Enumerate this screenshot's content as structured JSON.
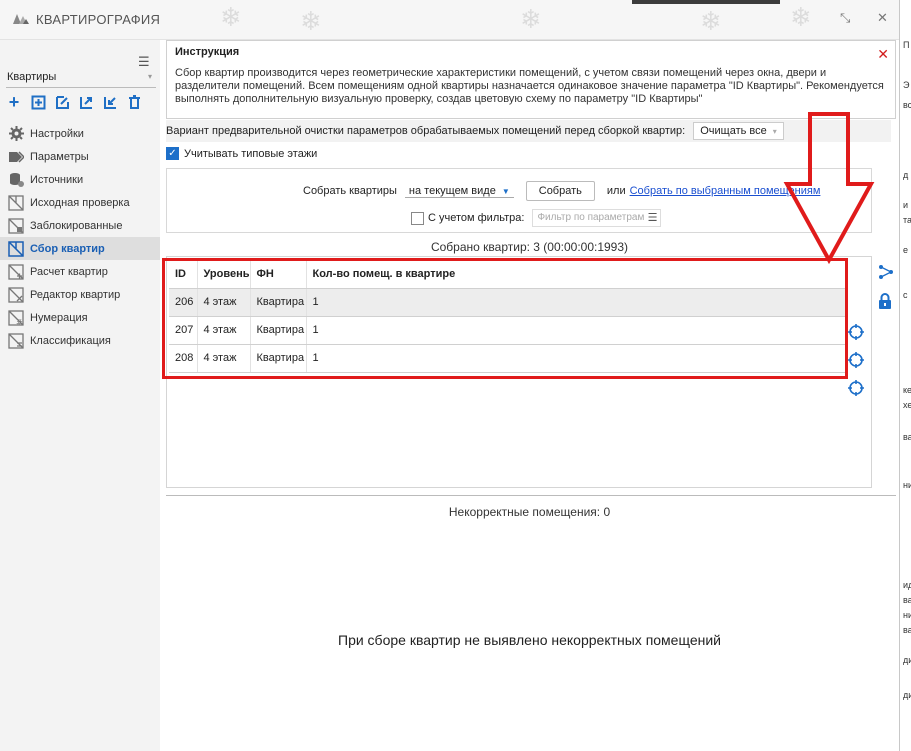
{
  "window": {
    "title": "КВАРТИРОГРАФИЯ",
    "minimize_icon": "shrink-icon",
    "close_glyph": "✕"
  },
  "sidebar": {
    "mode_select": "Квартиры",
    "toolbar_icons": [
      "add-icon",
      "add-box-icon",
      "edit-icon",
      "export-icon",
      "import-icon",
      "delete-icon"
    ],
    "items": [
      {
        "label": "Настройки",
        "icon": "gear-icon"
      },
      {
        "label": "Параметры",
        "icon": "tag-icon"
      },
      {
        "label": "Источники",
        "icon": "database-icon"
      },
      {
        "label": "Исходная проверка",
        "icon": "plan-check-icon"
      },
      {
        "label": "Заблокированные",
        "icon": "plan-lock-icon"
      },
      {
        "label": "Сбор квартир",
        "icon": "plan-collect-icon",
        "active": true
      },
      {
        "label": "Расчет квартир",
        "icon": "plan-calc-icon"
      },
      {
        "label": "Редактор квартир",
        "icon": "plan-edit-icon"
      },
      {
        "label": "Нумерация",
        "icon": "plan-number-icon"
      },
      {
        "label": "Классификация",
        "icon": "plan-classify-icon"
      }
    ]
  },
  "instruction": {
    "title": "Инструкция",
    "text": "Сбор квартир производится через геометрические характеристики помещений, с учетом связи помещений через окна, двери и разделители помещений. Всем помещениям одной квартиры назначается одинаковое значение параметра \"ID Квартиры\". Рекомендуется выполнять дополнительную визуальную проверку, создав цветовую схему по параметру \"ID Квартиры\""
  },
  "cleanup": {
    "label": "Вариант предварительной очистки параметров обрабатываемых помещений перед сборкой квартир:",
    "value": "Очищать все"
  },
  "typical_floors": {
    "label": "Учитывать типовые этажи",
    "checked": true
  },
  "collect": {
    "label": "Собрать квартиры",
    "view_value": "на текущем виде",
    "button": "Собрать",
    "or": "или",
    "link": "Собрать по выбранным помещениям",
    "filter_label": "С учетом фильтра:",
    "filter_placeholder": "Фильтр по параметрам"
  },
  "result": {
    "collected": "Собрано квартир: 3 (00:00:00:1993)"
  },
  "table": {
    "headers": [
      "ID",
      "Уровень",
      "ФН",
      "Кол-во помещ. в квартире"
    ],
    "rows": [
      [
        "206",
        "4 этаж",
        "Квартира",
        "1"
      ],
      [
        "207",
        "4 этаж",
        "Квартира",
        "1"
      ],
      [
        "208",
        "4 этаж",
        "Квартира",
        "1"
      ]
    ]
  },
  "incorrect": {
    "title": "Некорректные помещения: 0",
    "message": "При сборе квартир не выявлено некорректных помещений"
  },
  "colors": {
    "accent": "#1d6fc9",
    "annotation": "#e01b1b",
    "close": "#d21e1e"
  }
}
